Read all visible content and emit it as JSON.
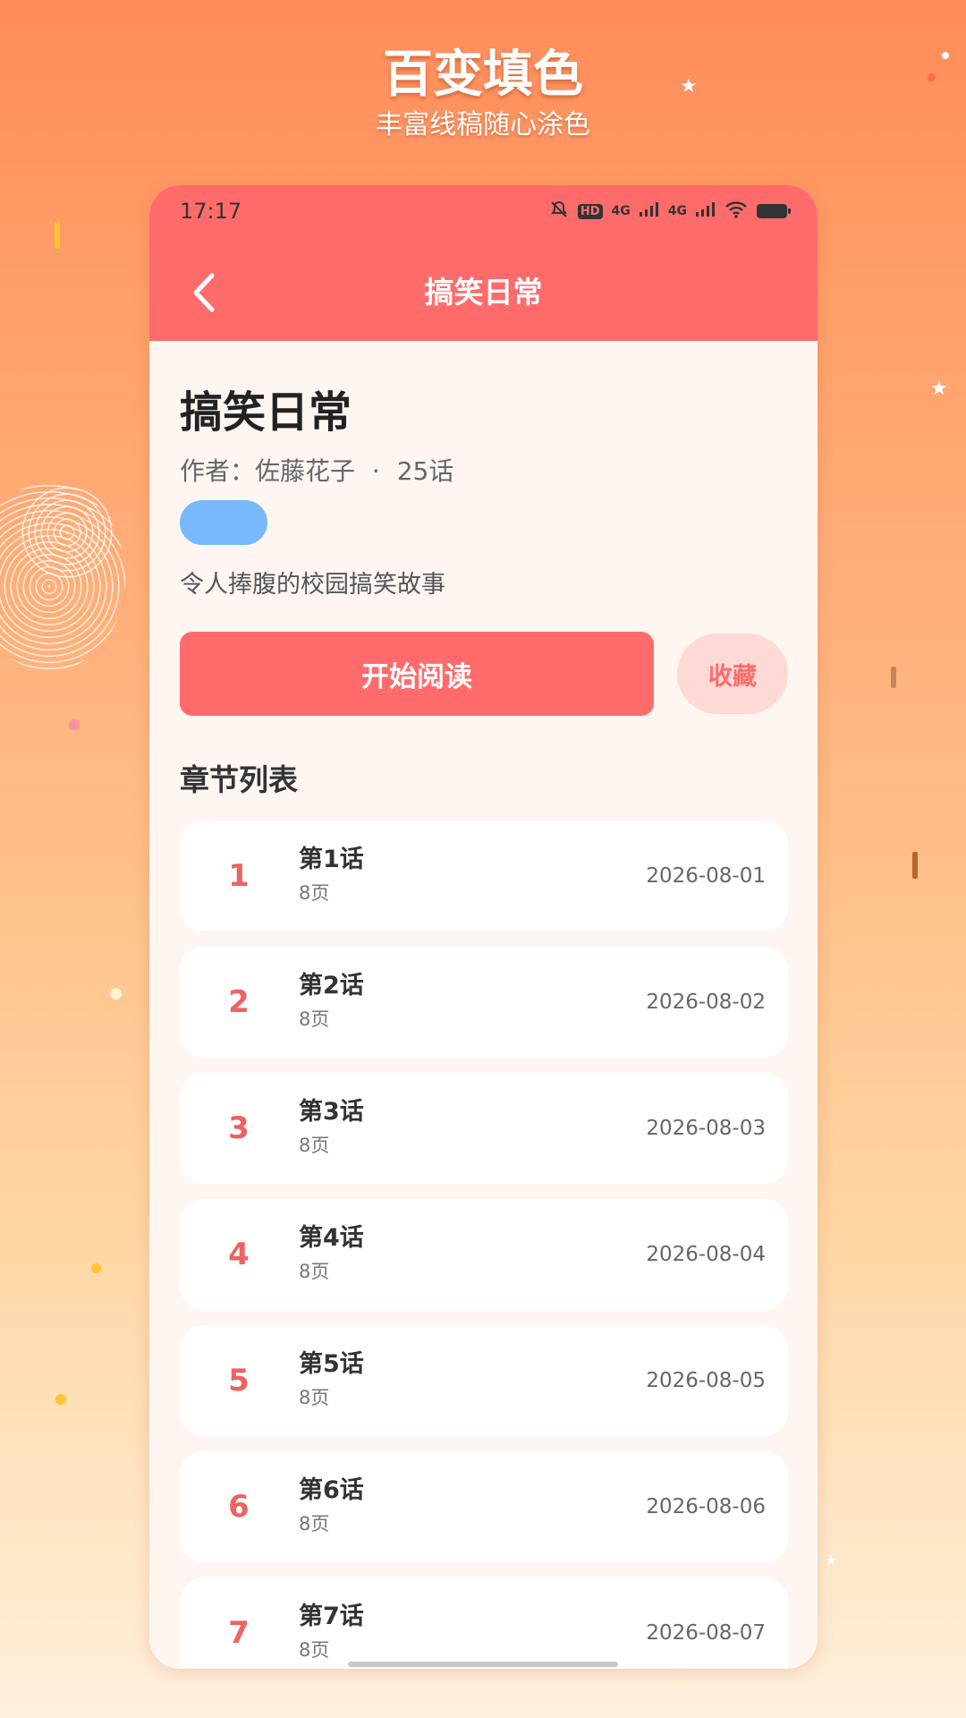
{
  "promo": {
    "title": "百变填色",
    "subtitle": "丰富线稿随心涂色"
  },
  "status_bar": {
    "time": "17:17",
    "hd_badge": "HD",
    "network_1": "4G",
    "network_2": "4G"
  },
  "header": {
    "title": "搞笑日常",
    "back_icon": "chevron-left-icon"
  },
  "book": {
    "title": "搞笑日常",
    "author": "作者：佐藤花子",
    "separator": "·",
    "chapter_count": "25话",
    "tag_color": "#77b9ff",
    "description": "令人捧腹的校园搞笑故事"
  },
  "actions": {
    "read_label": "开始阅读",
    "favorite_label": "收藏"
  },
  "section": {
    "title": "章节列表"
  },
  "chapters": [
    {
      "num": "1",
      "title": "第1话",
      "pages": "8页",
      "date": "2026-08-01"
    },
    {
      "num": "2",
      "title": "第2话",
      "pages": "8页",
      "date": "2026-08-02"
    },
    {
      "num": "3",
      "title": "第3话",
      "pages": "8页",
      "date": "2026-08-03"
    },
    {
      "num": "4",
      "title": "第4话",
      "pages": "8页",
      "date": "2026-08-04"
    },
    {
      "num": "5",
      "title": "第5话",
      "pages": "8页",
      "date": "2026-08-05"
    },
    {
      "num": "6",
      "title": "第6话",
      "pages": "8页",
      "date": "2026-08-06"
    },
    {
      "num": "7",
      "title": "第7话",
      "pages": "8页",
      "date": "2026-08-07"
    }
  ],
  "colors": {
    "accent": "#ff6b6b",
    "background": "#fff6f1",
    "favorite_bg": "#ffd9d6"
  }
}
